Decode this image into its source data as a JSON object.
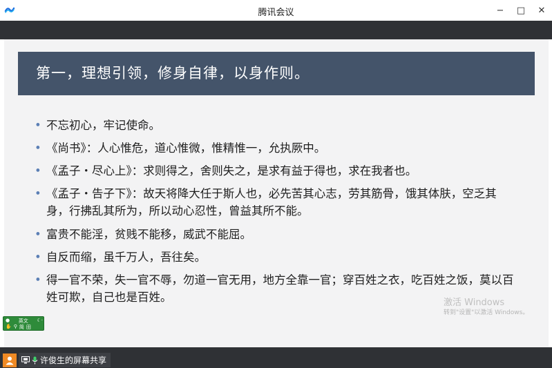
{
  "window": {
    "title": "腾讯会议",
    "minimize": "−",
    "maximize": "□",
    "close": "✕"
  },
  "slide": {
    "title": "第一，理想引领，修身自律，以身作则。",
    "bullets": [
      "不忘初心，牢记使命。",
      "《尚书》：人心惟危，道心惟微，惟精惟一，允执厥中。",
      "《孟子・尽心上》：求则得之，舍则失之，是求有益于得也，求在我者也。",
      "《孟子・告子下》：故天将降大任于斯人也，必先苦其心志，劳其筋骨，饿其体肤，空乏其身，行拂乱其所为，所以动心忍性，曾益其所不能。",
      "富贵不能淫，贫贱不能移，威武不能屈。",
      "自反而缩，虽千万人，吾往矣。",
      "得一官不荣，失一官不辱，勿道一官无用，地方全靠一官；穿百姓之衣，吃百姓之饭，莫以百姓可欺，自己也是百姓。"
    ]
  },
  "watermark": {
    "line1": "激活 Windows",
    "line2": "转到\"设置\"以激活 Windows。"
  },
  "ime": {
    "mode": "英文",
    "row2_a": "简",
    "row2_b": "田"
  },
  "share": {
    "label": "许俊生的屏幕共享"
  },
  "colors": {
    "header_bg": "#44546a",
    "bullet": "#5b7fb5",
    "bar_bg": "#2f3135",
    "avatar": "#f08a24"
  }
}
